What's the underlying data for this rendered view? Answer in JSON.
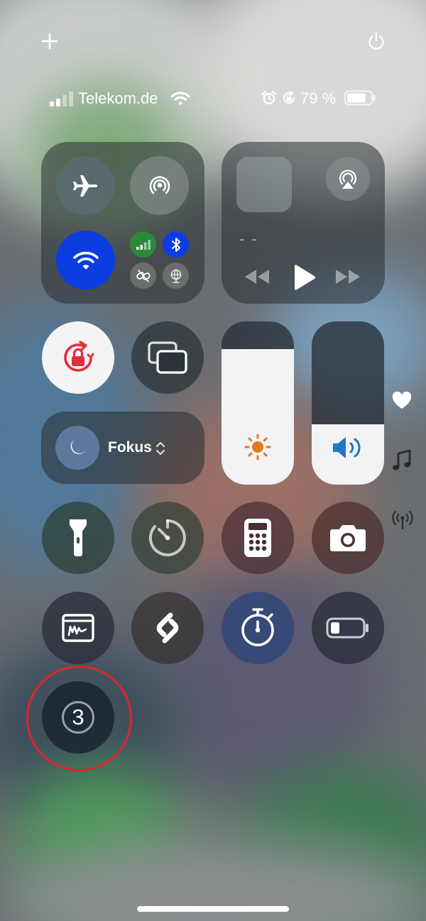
{
  "status_bar": {
    "carrier": "Telekom.de",
    "battery_label": "79 %",
    "battery_level": 0.79,
    "signal_bars_active": 2
  },
  "top_controls": {
    "add_icon": "plus-icon",
    "power_icon": "power-icon"
  },
  "connectivity": {
    "airplane_mode": "off",
    "airdrop": "off",
    "wifi": "on",
    "cellular": "on",
    "bluetooth": "on"
  },
  "now_playing": {
    "title": "- -"
  },
  "focus": {
    "label": "Fokus"
  },
  "sliders": {
    "brightness_level": 0.83,
    "volume_level": 0.37
  },
  "timer_badge": {
    "value": "3"
  },
  "side_icons": [
    "heart-icon",
    "music-note-icon",
    "antenna-icon"
  ],
  "colors": {
    "accent_blue": "#0a3ee0",
    "cellular_green": "#2a8a3a",
    "bluetooth_blue": "#0a3ee0",
    "highlight_red": "#e0242b",
    "orientation_lock_red": "#e0303a",
    "brightness_orange": "#e27a18",
    "volume_blue": "#1d78c8"
  }
}
